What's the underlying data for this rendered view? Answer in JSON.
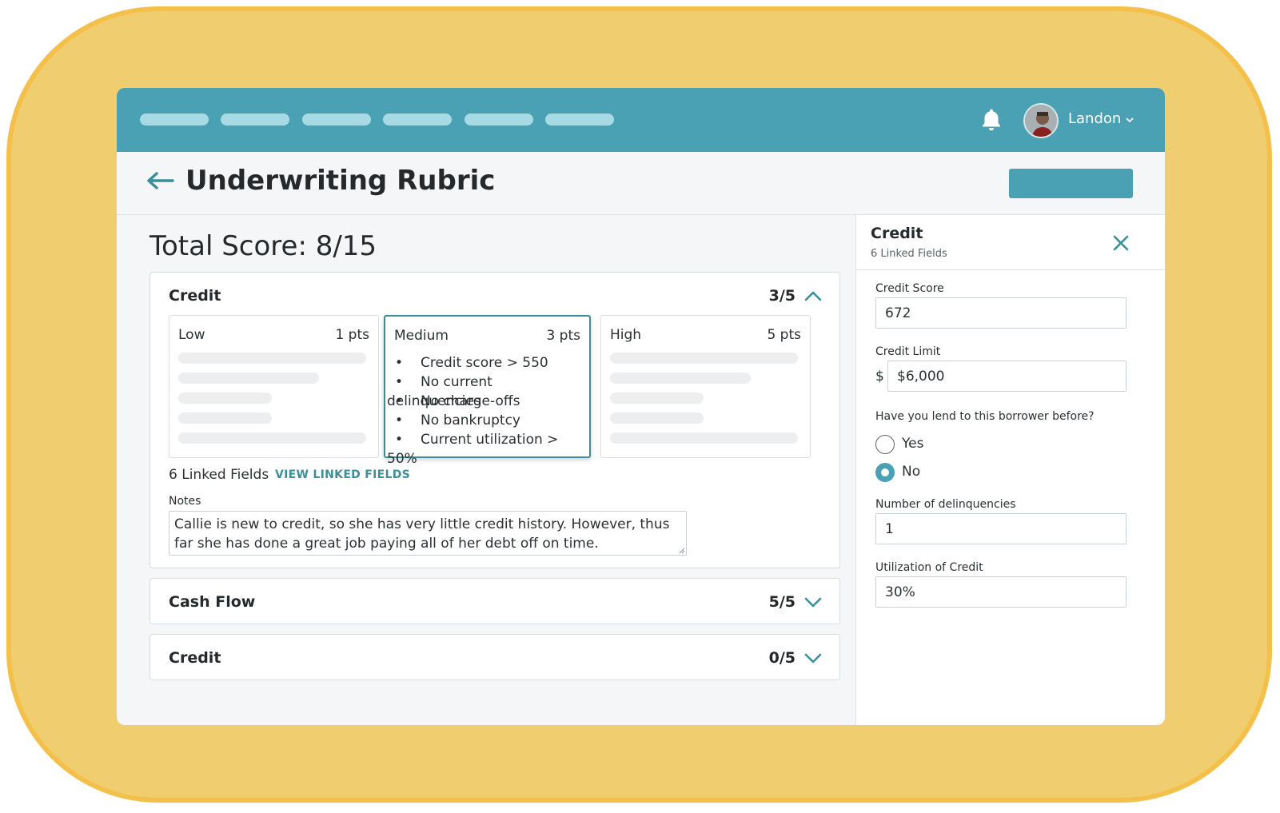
{
  "topnav": {
    "user_name": "Landon",
    "icons": [
      "bell-icon",
      "avatar",
      "chevron-down-icon"
    ]
  },
  "page": {
    "title": "Underwriting Rubric",
    "total_score": "Total Score: 8/15"
  },
  "sections": [
    {
      "title": "Credit",
      "score": "3/5",
      "expanded": true,
      "tiers": [
        {
          "name": "Low",
          "pts": "1 pts",
          "criteria": []
        },
        {
          "name": "Medium",
          "pts": "3 pts",
          "selected": true,
          "criteria": [
            "Credit score > 550",
            "No current delinquencies",
            "No charge-offs",
            "No bankruptcy",
            "Current utilization > 50%"
          ]
        },
        {
          "name": "High",
          "pts": "5 pts",
          "criteria": []
        }
      ],
      "linked_fields": "6 Linked Fields",
      "view_linked_label": "VIEW LINKED FIELDS",
      "notes_label": "Notes",
      "notes_value": "Callie is new to credit, so she has very little credit history. However, thus far she has done a great job paying all of her debt off on time."
    },
    {
      "title": "Cash Flow",
      "score": "5/5",
      "expanded": false
    },
    {
      "title": "Credit",
      "score": "0/5",
      "expanded": false
    }
  ],
  "panel": {
    "title": "Credit",
    "subtitle": "6 Linked Fields",
    "fields": {
      "credit_score": {
        "label": "Credit Score",
        "value": "672"
      },
      "credit_limit": {
        "label": "Credit Limit",
        "prefix": "$",
        "value": "$6,000"
      },
      "lent_before": {
        "label": "Have you lend to this borrower before?",
        "options": [
          "Yes",
          "No"
        ],
        "selected": "No"
      },
      "delinquencies": {
        "label": "Number of delinquencies",
        "value": "1"
      },
      "utilization": {
        "label": "Utilization of Credit",
        "value": "30%"
      }
    }
  },
  "colors": {
    "accent": "#4aa1b3",
    "frame": "#f0cd6e",
    "frame_border": "#f4c04a",
    "link": "#3b8f9a"
  }
}
